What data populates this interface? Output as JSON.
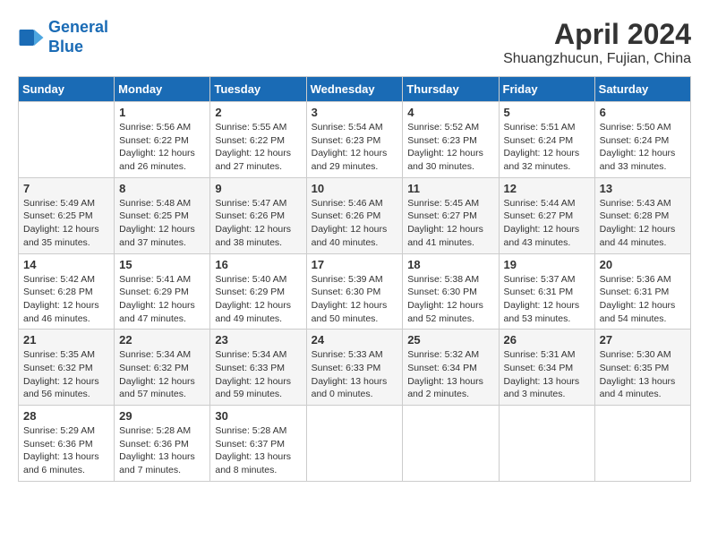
{
  "header": {
    "logo_line1": "General",
    "logo_line2": "Blue",
    "month": "April 2024",
    "location": "Shuangzhucun, Fujian, China"
  },
  "weekdays": [
    "Sunday",
    "Monday",
    "Tuesday",
    "Wednesday",
    "Thursday",
    "Friday",
    "Saturday"
  ],
  "weeks": [
    [
      {
        "day": "",
        "sunrise": "",
        "sunset": "",
        "daylight": ""
      },
      {
        "day": "1",
        "sunrise": "Sunrise: 5:56 AM",
        "sunset": "Sunset: 6:22 PM",
        "daylight": "Daylight: 12 hours and 26 minutes."
      },
      {
        "day": "2",
        "sunrise": "Sunrise: 5:55 AM",
        "sunset": "Sunset: 6:22 PM",
        "daylight": "Daylight: 12 hours and 27 minutes."
      },
      {
        "day": "3",
        "sunrise": "Sunrise: 5:54 AM",
        "sunset": "Sunset: 6:23 PM",
        "daylight": "Daylight: 12 hours and 29 minutes."
      },
      {
        "day": "4",
        "sunrise": "Sunrise: 5:52 AM",
        "sunset": "Sunset: 6:23 PM",
        "daylight": "Daylight: 12 hours and 30 minutes."
      },
      {
        "day": "5",
        "sunrise": "Sunrise: 5:51 AM",
        "sunset": "Sunset: 6:24 PM",
        "daylight": "Daylight: 12 hours and 32 minutes."
      },
      {
        "day": "6",
        "sunrise": "Sunrise: 5:50 AM",
        "sunset": "Sunset: 6:24 PM",
        "daylight": "Daylight: 12 hours and 33 minutes."
      }
    ],
    [
      {
        "day": "7",
        "sunrise": "Sunrise: 5:49 AM",
        "sunset": "Sunset: 6:25 PM",
        "daylight": "Daylight: 12 hours and 35 minutes."
      },
      {
        "day": "8",
        "sunrise": "Sunrise: 5:48 AM",
        "sunset": "Sunset: 6:25 PM",
        "daylight": "Daylight: 12 hours and 37 minutes."
      },
      {
        "day": "9",
        "sunrise": "Sunrise: 5:47 AM",
        "sunset": "Sunset: 6:26 PM",
        "daylight": "Daylight: 12 hours and 38 minutes."
      },
      {
        "day": "10",
        "sunrise": "Sunrise: 5:46 AM",
        "sunset": "Sunset: 6:26 PM",
        "daylight": "Daylight: 12 hours and 40 minutes."
      },
      {
        "day": "11",
        "sunrise": "Sunrise: 5:45 AM",
        "sunset": "Sunset: 6:27 PM",
        "daylight": "Daylight: 12 hours and 41 minutes."
      },
      {
        "day": "12",
        "sunrise": "Sunrise: 5:44 AM",
        "sunset": "Sunset: 6:27 PM",
        "daylight": "Daylight: 12 hours and 43 minutes."
      },
      {
        "day": "13",
        "sunrise": "Sunrise: 5:43 AM",
        "sunset": "Sunset: 6:28 PM",
        "daylight": "Daylight: 12 hours and 44 minutes."
      }
    ],
    [
      {
        "day": "14",
        "sunrise": "Sunrise: 5:42 AM",
        "sunset": "Sunset: 6:28 PM",
        "daylight": "Daylight: 12 hours and 46 minutes."
      },
      {
        "day": "15",
        "sunrise": "Sunrise: 5:41 AM",
        "sunset": "Sunset: 6:29 PM",
        "daylight": "Daylight: 12 hours and 47 minutes."
      },
      {
        "day": "16",
        "sunrise": "Sunrise: 5:40 AM",
        "sunset": "Sunset: 6:29 PM",
        "daylight": "Daylight: 12 hours and 49 minutes."
      },
      {
        "day": "17",
        "sunrise": "Sunrise: 5:39 AM",
        "sunset": "Sunset: 6:30 PM",
        "daylight": "Daylight: 12 hours and 50 minutes."
      },
      {
        "day": "18",
        "sunrise": "Sunrise: 5:38 AM",
        "sunset": "Sunset: 6:30 PM",
        "daylight": "Daylight: 12 hours and 52 minutes."
      },
      {
        "day": "19",
        "sunrise": "Sunrise: 5:37 AM",
        "sunset": "Sunset: 6:31 PM",
        "daylight": "Daylight: 12 hours and 53 minutes."
      },
      {
        "day": "20",
        "sunrise": "Sunrise: 5:36 AM",
        "sunset": "Sunset: 6:31 PM",
        "daylight": "Daylight: 12 hours and 54 minutes."
      }
    ],
    [
      {
        "day": "21",
        "sunrise": "Sunrise: 5:35 AM",
        "sunset": "Sunset: 6:32 PM",
        "daylight": "Daylight: 12 hours and 56 minutes."
      },
      {
        "day": "22",
        "sunrise": "Sunrise: 5:34 AM",
        "sunset": "Sunset: 6:32 PM",
        "daylight": "Daylight: 12 hours and 57 minutes."
      },
      {
        "day": "23",
        "sunrise": "Sunrise: 5:34 AM",
        "sunset": "Sunset: 6:33 PM",
        "daylight": "Daylight: 12 hours and 59 minutes."
      },
      {
        "day": "24",
        "sunrise": "Sunrise: 5:33 AM",
        "sunset": "Sunset: 6:33 PM",
        "daylight": "Daylight: 13 hours and 0 minutes."
      },
      {
        "day": "25",
        "sunrise": "Sunrise: 5:32 AM",
        "sunset": "Sunset: 6:34 PM",
        "daylight": "Daylight: 13 hours and 2 minutes."
      },
      {
        "day": "26",
        "sunrise": "Sunrise: 5:31 AM",
        "sunset": "Sunset: 6:34 PM",
        "daylight": "Daylight: 13 hours and 3 minutes."
      },
      {
        "day": "27",
        "sunrise": "Sunrise: 5:30 AM",
        "sunset": "Sunset: 6:35 PM",
        "daylight": "Daylight: 13 hours and 4 minutes."
      }
    ],
    [
      {
        "day": "28",
        "sunrise": "Sunrise: 5:29 AM",
        "sunset": "Sunset: 6:36 PM",
        "daylight": "Daylight: 13 hours and 6 minutes."
      },
      {
        "day": "29",
        "sunrise": "Sunrise: 5:28 AM",
        "sunset": "Sunset: 6:36 PM",
        "daylight": "Daylight: 13 hours and 7 minutes."
      },
      {
        "day": "30",
        "sunrise": "Sunrise: 5:28 AM",
        "sunset": "Sunset: 6:37 PM",
        "daylight": "Daylight: 13 hours and 8 minutes."
      },
      {
        "day": "",
        "sunrise": "",
        "sunset": "",
        "daylight": ""
      },
      {
        "day": "",
        "sunrise": "",
        "sunset": "",
        "daylight": ""
      },
      {
        "day": "",
        "sunrise": "",
        "sunset": "",
        "daylight": ""
      },
      {
        "day": "",
        "sunrise": "",
        "sunset": "",
        "daylight": ""
      }
    ]
  ]
}
